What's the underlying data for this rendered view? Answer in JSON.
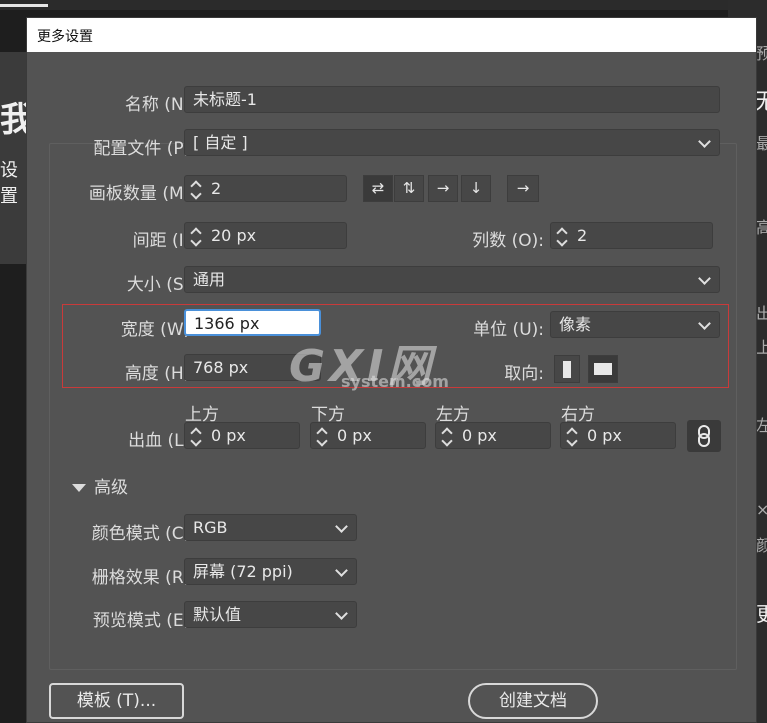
{
  "background": {
    "left_big_char": "我",
    "left_small_text": "设置",
    "right_chars": [
      "预",
      "无",
      "最",
      "高",
      "出",
      "上",
      "左",
      "×",
      "颜",
      "更"
    ]
  },
  "dialog": {
    "title": "更多设置",
    "name": {
      "label": "名称 (N):",
      "value": "未标题-1"
    },
    "profile": {
      "label": "配置文件 (P):",
      "value": "[ 自定 ]"
    },
    "artboards": {
      "label": "画板数量 (M):",
      "value": "2"
    },
    "arrange_icons": [
      "grid-by-row-icon",
      "grid-by-column-icon",
      "arrange-by-row-icon",
      "arrange-by-column-icon",
      "right-to-left-icon"
    ],
    "arrange_glyphs": [
      "⇄",
      "⇅",
      "→",
      "↓",
      "→"
    ],
    "spacing": {
      "label": "间距 (I):",
      "value": "20 px"
    },
    "columns": {
      "label": "列数 (O):",
      "value": "2"
    },
    "size": {
      "label": "大小 (S):",
      "value": "通用"
    },
    "width": {
      "label": "宽度 (W):",
      "value": "1366 px"
    },
    "units": {
      "label": "单位 (U):",
      "value": "像素"
    },
    "height": {
      "label": "高度 (H):",
      "value": "768 px"
    },
    "orientation": {
      "label": "取向:",
      "options": [
        "portrait",
        "landscape"
      ],
      "selected": "landscape"
    },
    "bleed": {
      "label": "出血 (L):",
      "top": {
        "label": "上方",
        "value": "0 px"
      },
      "bottom": {
        "label": "下方",
        "value": "0 px"
      },
      "left": {
        "label": "左方",
        "value": "0 px"
      },
      "right": {
        "label": "右方",
        "value": "0 px"
      }
    },
    "advanced_label": "高级",
    "color_mode": {
      "label": "颜色模式 (C):",
      "value": "RGB"
    },
    "raster_effects": {
      "label": "栅格效果 (R):",
      "value": "屏幕 (72 ppi)"
    },
    "preview_mode": {
      "label": "预览模式 (E):",
      "value": "默认值"
    },
    "buttons": {
      "template": "模板 (T)...",
      "create": "创建文档"
    }
  },
  "watermark": {
    "main": "GXI网",
    "sub": "system.com"
  },
  "colors": {
    "highlight_box": "#c93a3a",
    "dialog_bg": "#535353",
    "focus": "#4a90d9"
  }
}
